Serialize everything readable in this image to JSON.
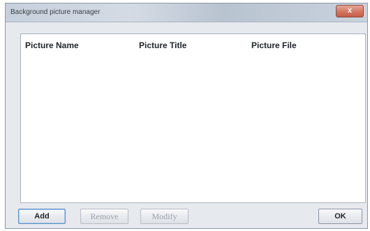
{
  "window": {
    "title": "Background picture manager",
    "close_label": "x"
  },
  "table": {
    "columns": [
      "Picture Name",
      "Picture Title",
      "Picture File"
    ],
    "rows": []
  },
  "buttons": {
    "add": "Add",
    "remove": "Remove",
    "modify": "Modify",
    "ok": "OK"
  }
}
